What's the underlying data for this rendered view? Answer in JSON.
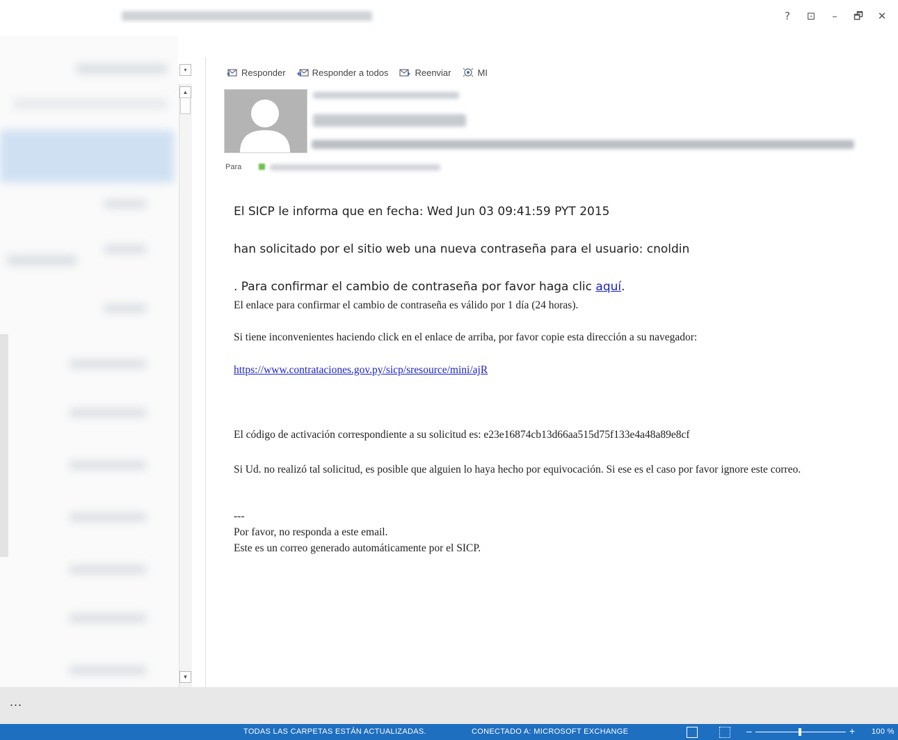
{
  "window": {
    "buttons": {
      "help": "?",
      "ribbon": "⊡",
      "minimize": "–",
      "restore": "🗗",
      "close": "✕"
    }
  },
  "toolbar": {
    "reply": "Responder",
    "reply_all": "Responder a todos",
    "forward": "Reenviar",
    "im": "MI"
  },
  "header": {
    "to_label": "Para"
  },
  "message": {
    "line1": "El SICP le informa que en fecha: Wed Jun 03 09:41:59 PYT 2015",
    "line2": "han solicitado por el sitio web una nueva contraseña para el usuario: cnoldin",
    "line3_prefix": ". Para confirmar el cambio de contraseña por favor haga clic ",
    "line3_link": "aquí",
    "line3_suffix": ".",
    "validity": "El enlace para confirmar el cambio de contraseña es válido por 1 día (24 horas).",
    "trouble": "Si tiene inconvenientes haciendo click en el enlace de arriba, por favor copie esta dirección a su navegador:",
    "url": "https://www.contrataciones.gov.py/sicp/sresource/mini/ajR",
    "activation": "El código de activación correspondiente a su solicitud es: e23e16874cb13d66aa515d75f133e4a48a89e8cf",
    "mistake": "Si Ud. no realizó tal solicitud, es posible que alguien lo haya hecho por equivocación. Si ese es el caso por favor ignore este correo.",
    "separator": "---",
    "no_reply": "Por favor, no responda a este email.",
    "auto": "Este es un correo generado automáticamente por el SICP."
  },
  "nav": {
    "more": "..."
  },
  "status": {
    "folders": "TODAS LAS CARPETAS ESTÁN ACTUALIZADAS.",
    "connection": "CONECTADO A: MICROSOFT EXCHANGE",
    "zoom": "100 %",
    "zoom_level_percent": 100
  },
  "colors": {
    "status_bar": "#1f6fc0",
    "link": "#1a22c8",
    "presence": "#6cc04a"
  }
}
